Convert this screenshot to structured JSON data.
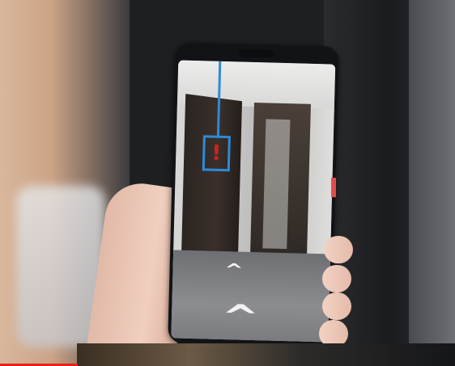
{
  "scene": {
    "marker_symbol": "!",
    "chevron_symbol": "^",
    "accent_color": "#2d8bd6",
    "alert_color": "#d2231d",
    "progress_color": "#e62117",
    "progress_fraction": 0.17
  }
}
